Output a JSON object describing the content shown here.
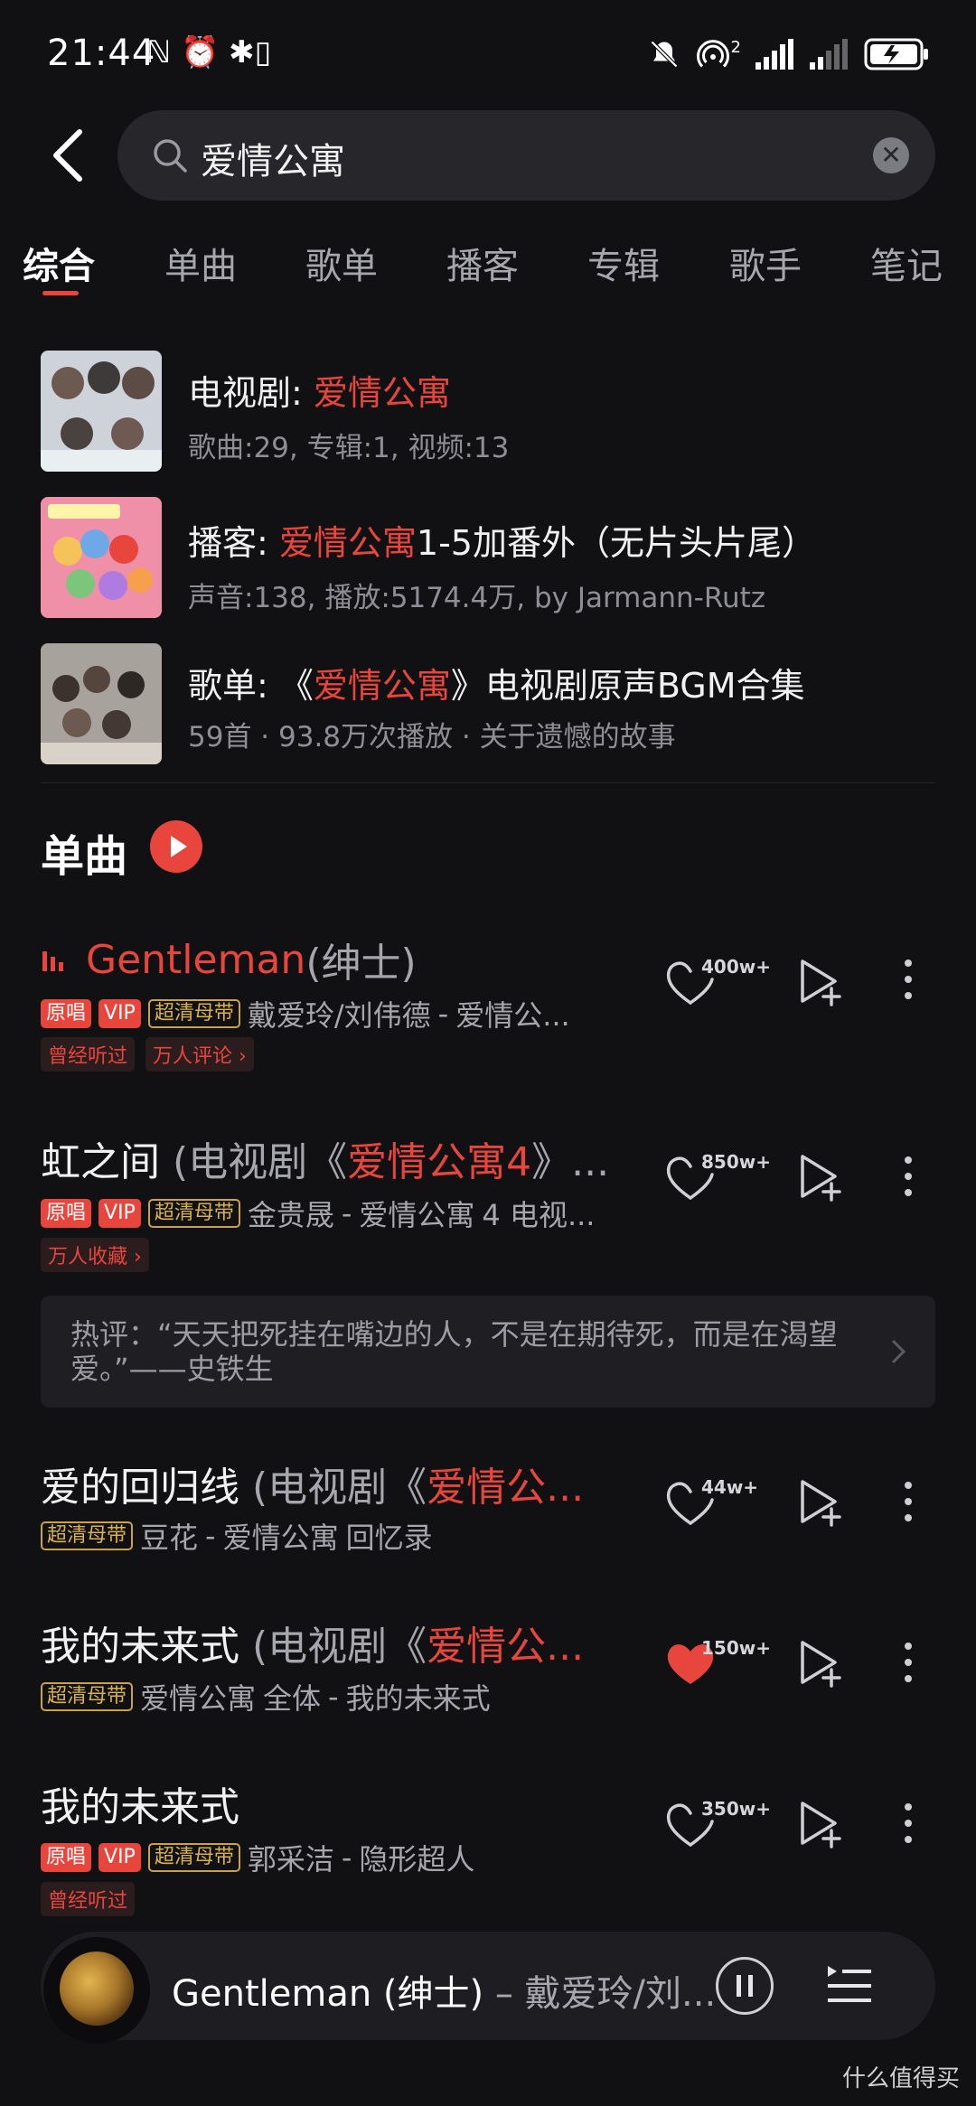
{
  "status_bar": {
    "time": "21:44",
    "left_icons": "ℕ ⏰ ✱▯",
    "network_sup": "2"
  },
  "search": {
    "query": "爱情公寓"
  },
  "tabs": [
    "综合",
    "单曲",
    "歌单",
    "播客",
    "专辑",
    "歌手",
    "笔记"
  ],
  "top_results": [
    {
      "prefix": "电视剧: ",
      "highlight": "爱情公寓",
      "suffix": "",
      "sub": "歌曲:29, 专辑:1, 视频:13"
    },
    {
      "prefix": "播客: ",
      "highlight": "爱情公寓",
      "suffix": "1-5加番外（无片头片尾）",
      "sub": "声音:138, 播放:5174.4万, by Jarmann-Rutz"
    },
    {
      "prefix": "歌单: 《",
      "highlight": "爱情公寓",
      "suffix": "》电视剧原声BGM合集",
      "sub": "59首 · 93.8万次播放 · 关于遗憾的故事"
    }
  ],
  "section": {
    "title": "单曲"
  },
  "songs": [
    {
      "title": "Gentleman",
      "title_sub": " (绅士)",
      "tags": [
        "原唱",
        "VIP",
        "超清母带"
      ],
      "artist": "戴爱玲/刘伟德",
      "sep": " - ",
      "album": "爱情公...",
      "pills": [
        "曾经听过",
        "万人评论 ›"
      ],
      "likes": "400w+"
    },
    {
      "title": "虹之间",
      "title_sub_a": " (电视剧《",
      "title_red": "爱情公寓4",
      "title_sub_b": "》...",
      "tags": [
        "原唱",
        "VIP",
        "超清母带"
      ],
      "artist": "金贵晟",
      "sep": " - ",
      "album_red": "爱情公寓",
      "album_rest": "4 电视...",
      "pills": [
        "万人收藏 ›"
      ],
      "likes": "850w+",
      "hot_comment": "热评：“天天把死挂在嘴边的人，不是在期待死，而是在渴望爱。”——史铁生"
    },
    {
      "title": "爱的回归线",
      "title_sub_a": " (电视剧《",
      "title_red": "爱情公...",
      "tags": [
        "超清母带"
      ],
      "artist": "豆花",
      "sep": " - ",
      "album_red": "爱情公寓",
      "album_rest": " 回忆录",
      "likes": "44w+"
    },
    {
      "title": "我的未来式",
      "title_sub_a": " (电视剧《",
      "title_red": "爱情公...",
      "tags": [
        "超清母带"
      ],
      "artist_red": "爱情公寓",
      "artist_rest": "全体",
      "sep": " - ",
      "album": "我的未来式",
      "likes": "150w+",
      "liked": true
    },
    {
      "title": "我的未来式",
      "tags": [
        "原唱",
        "VIP",
        "超清母带"
      ],
      "artist": "郭采洁",
      "sep": " - ",
      "album": "隐形超人",
      "pills": [
        "曾经听过"
      ],
      "likes": "350w+"
    }
  ],
  "player": {
    "title": "Gentleman (绅士)",
    "artist": " – 戴爱玲/刘..."
  },
  "watermark": "什么值得买",
  "colors": {
    "accent": "#e8453c",
    "background": "#111114",
    "gold_tag": "#d8b24e"
  }
}
